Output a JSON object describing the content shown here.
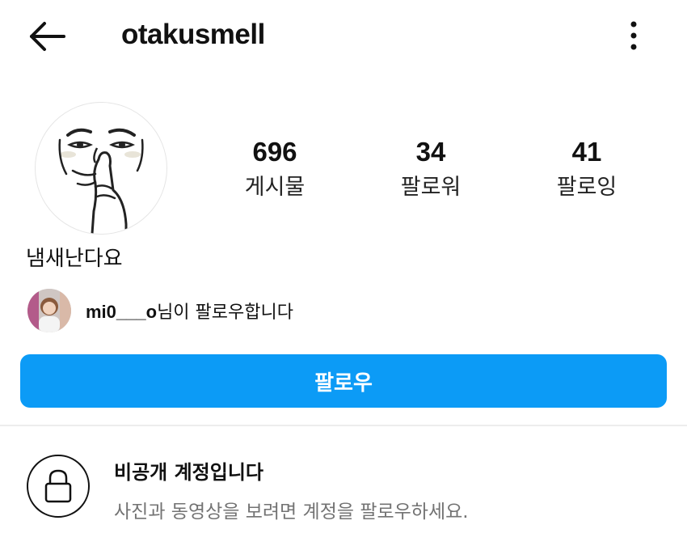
{
  "header": {
    "username": "otakusmell",
    "back_icon": "arrow-left-icon",
    "more_icon": "vertical-dots-icon"
  },
  "profile": {
    "avatar_description_icon": "meme-face-avatar",
    "bio": "냄새난다요"
  },
  "stats": {
    "posts": {
      "value": "696",
      "label": "게시물"
    },
    "followers": {
      "value": "34",
      "label": "팔로워"
    },
    "following": {
      "value": "41",
      "label": "팔로잉"
    }
  },
  "followed_by": {
    "username": "mi0___o",
    "suffix": "님이 팔로우합니다"
  },
  "follow_button": {
    "label": "팔로우",
    "color": "#0c9bf6"
  },
  "private_account": {
    "icon": "lock-icon",
    "title": "비공개 계정입니다",
    "description": "사진과 동영상을 보려면 계정을 팔로우하세요."
  }
}
